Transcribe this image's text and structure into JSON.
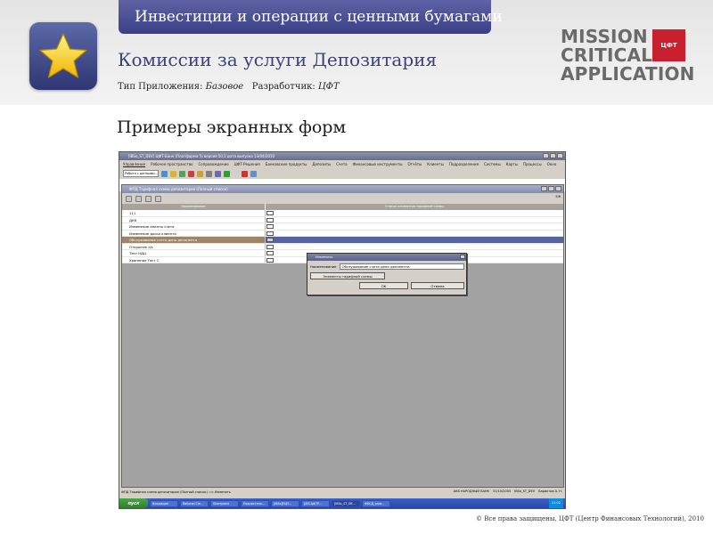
{
  "section_tab": "Инвестиции и операции с ценными бумагами",
  "app": {
    "title": "Комиссии за услуги Депозитария",
    "type_label": "Тип  Приложения:",
    "type_value": "Базовое",
    "dev_label": "Разработчик:",
    "dev_value": "ЦФТ"
  },
  "logo": {
    "line1": "MISSION",
    "line2": "CRITICAL",
    "line3": "APPLICATION",
    "badge": "ЦФТ"
  },
  "screens_title": "Примеры экранных форм",
  "screenshot": {
    "window_title": "[IBSo_ST_DEV] ЦФТ-Банк (Платформа 5) версия 50.2 дата выпуска 13/04/2010",
    "menu": [
      "Управление",
      "Рабочее пространство",
      "Сопровождение",
      "ЦФТ-Решения",
      "Банковские продукты",
      "Депозиты",
      "Счета",
      "Финансовые инструменты",
      "Отчёты",
      "Клиенты",
      "Подразделения",
      "Системы",
      "Карты",
      "Процессы",
      "Окно"
    ],
    "toolbar_combo": "Работа с данными...",
    "child_title": "ФПД Тарифная схема депозитария (Полный список)",
    "count": "5/6",
    "col_name": "Наименование",
    "col_list": "Список элементов тарифной схемы",
    "rows": [
      {
        "name": "111",
        "selected": false
      },
      {
        "name": "ДКК",
        "selected": false
      },
      {
        "name": "Изменение анкеты счета",
        "selected": false
      },
      {
        "name": "Изменение досье клиента",
        "selected": false
      },
      {
        "name": "Обслуживание счета депо депонента",
        "selected": true
      },
      {
        "name": "Открытие л/с",
        "selected": false
      },
      {
        "name": "Тест НДЦ",
        "selected": false
      },
      {
        "name": "Хранение Тест 1",
        "selected": false
      }
    ],
    "dialog": {
      "title": "Изменить",
      "field_label": "Наименование",
      "field_value": "Обслуживание счета депо депонента",
      "elements_button": "Элементы тарифной схемы",
      "ok": "OK",
      "cancel": "Отмена"
    },
    "status": "ФПД Тарифная схема депозитария (Полный список) => Изменить",
    "status_right": [
      "АКБ НАРОДНЫЙ БАНК",
      "31/10/2005",
      "IBSo_ST_DEV",
      "Бариктов А. Н."
    ],
    "taskbar": {
      "start": "пуск",
      "tasks": [
        "Входящие",
        "Rational Cle...",
        "Sharepoint",
        "Подчистано...",
        "[IBSo]ЕЦП...",
        "[IBS-ЦФТР...",
        "[IBSo_ST_DE...",
        "ФКСД_рrов..."
      ],
      "clock": "11:02"
    }
  },
  "footer": "© Все права защищены, ЦФТ (Центр Финансовых Технологий), 2010"
}
